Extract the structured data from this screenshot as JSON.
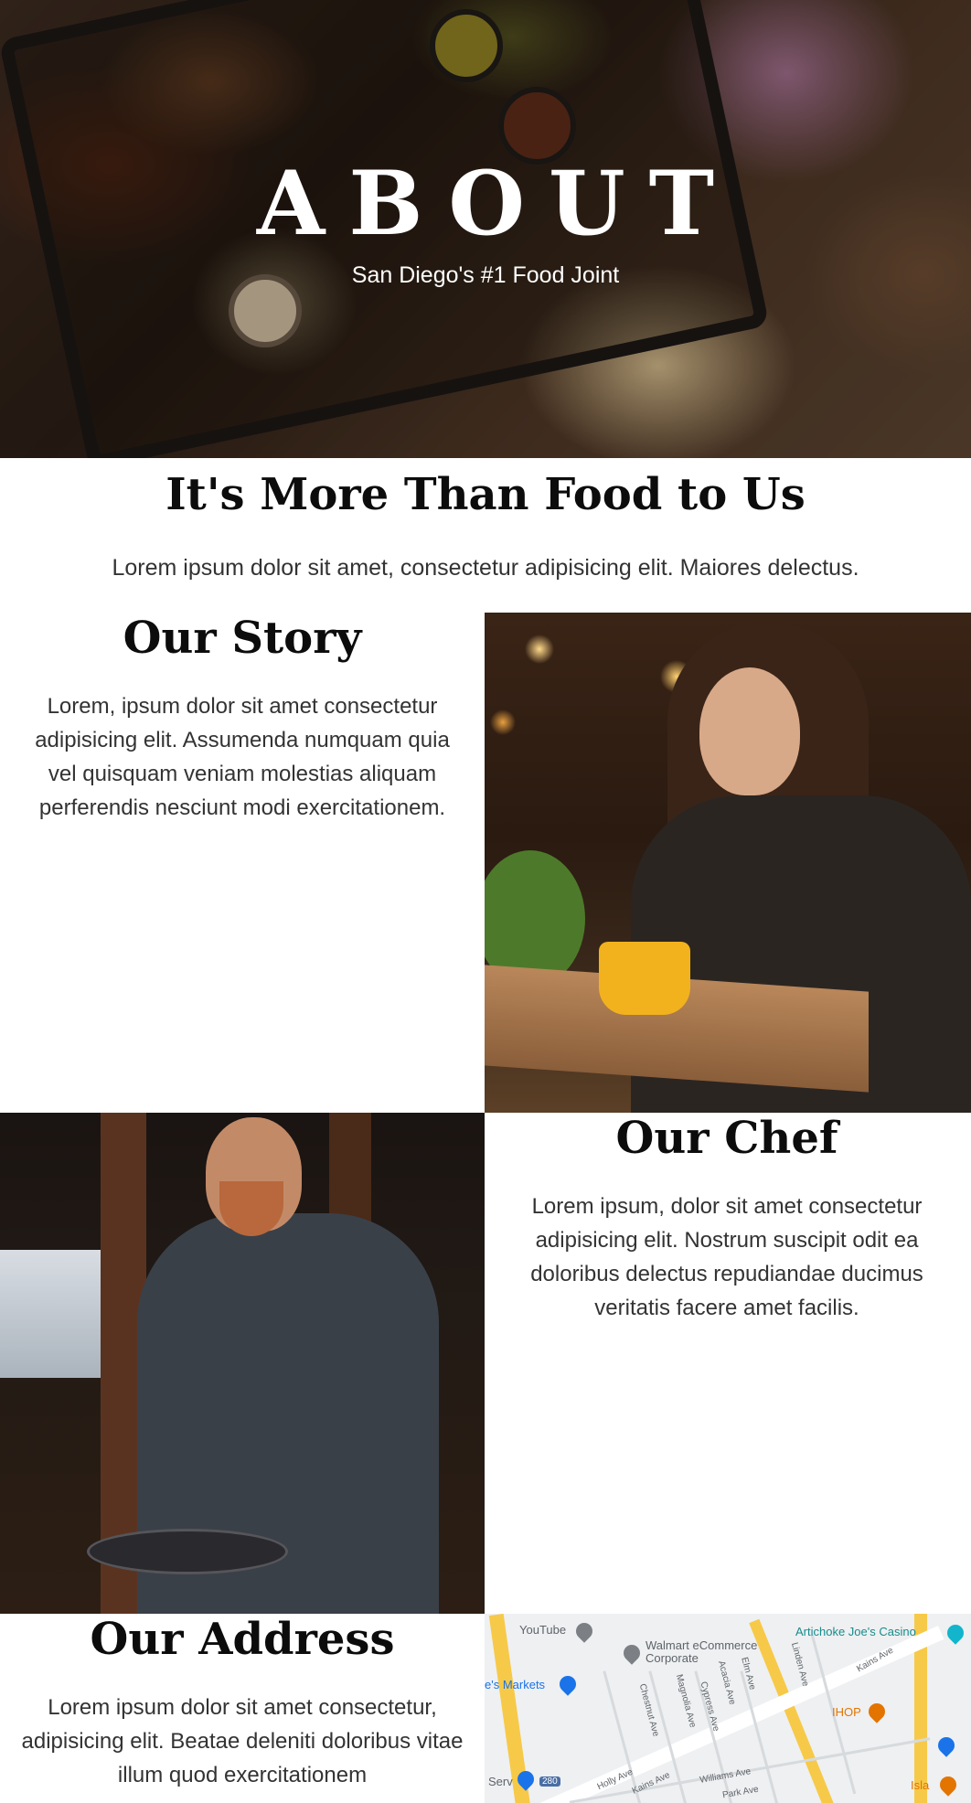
{
  "hero": {
    "title": "ABOUT",
    "subtitle": "San Diego's #1 Food Joint"
  },
  "intro": {
    "heading": "It's More Than Food to Us",
    "text": "Lorem ipsum dolor sit amet, consectetur adipisicing elit. Maiores delectus."
  },
  "story": {
    "heading": "Our Story",
    "text": "Lorem, ipsum dolor sit amet consectetur adipisicing elit. Assumenda numquam quia vel quisquam veniam molestias aliquam perferendis nesciunt modi exercitationem."
  },
  "chef": {
    "heading": "Our Chef",
    "text": "Lorem ipsum, dolor sit amet consectetur adipisicing elit. Nostrum suscipit odit ea doloribus delectus repudiandae ducimus veritatis facere amet facilis."
  },
  "address": {
    "heading": "Our Address",
    "text": "Lorem ipsum dolor sit amet consectetur, adipisicing elit. Beatae deleniti doloribus vitae illum quod exercitationem"
  },
  "map": {
    "labels": {
      "youtube": "YouTube",
      "walmart": "Walmart eCommerce Corporate",
      "artichoke": "Artichoke Joe's Casino",
      "markets": "e's Markets",
      "ihop": "IHOP",
      "isla": "Isla",
      "serv": "Serv",
      "chestnut": "Chestnut Ave",
      "acacia": "Acacia Ave",
      "elm": "Elm Ave",
      "cypress": "Cypress Ave",
      "magnolia": "Magnolia Ave",
      "linden": "Linden Ave",
      "kains": "Kains Ave",
      "kains2": "Kains Ave",
      "holly": "Holly Ave",
      "williams": "Williams Ave",
      "park": "Park Ave",
      "hwy": "280"
    },
    "colors": {
      "highway": "#f7c948",
      "poi_blue": "#1a73e8",
      "poi_orange": "#e37400",
      "poi_teal": "#12b5cb"
    }
  }
}
